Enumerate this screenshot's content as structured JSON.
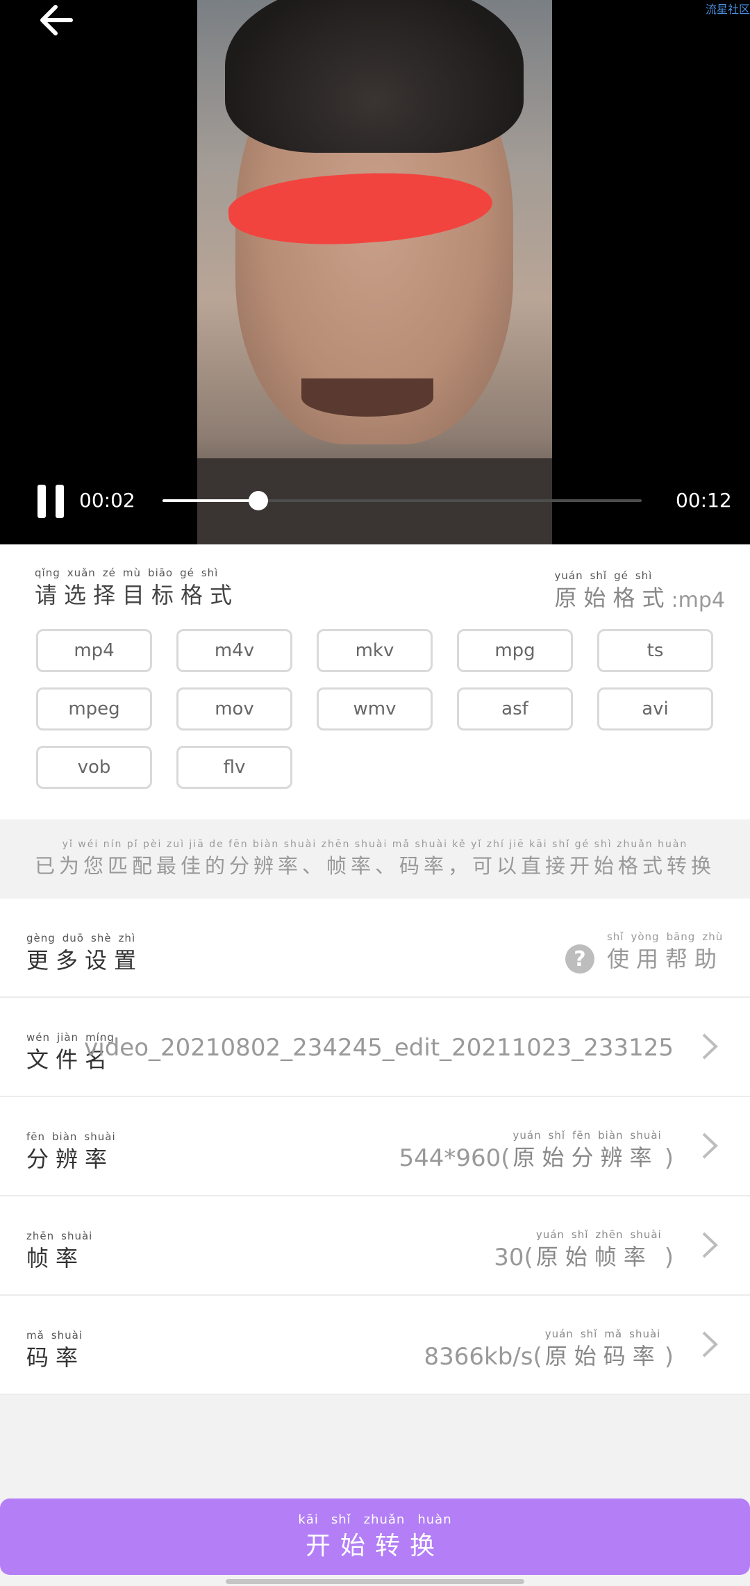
{
  "player": {
    "current_time": "00:02",
    "total_time": "00:12",
    "progress": 0.2,
    "corner_tag": "流星社区"
  },
  "format": {
    "title_pinyin": [
      "qǐng",
      "xuǎn",
      "zé",
      "mù",
      "biāo",
      "gé",
      "shì"
    ],
    "title": "请选择目标格式",
    "original_pinyin": [
      "yuán",
      "shǐ",
      "gé",
      "shì"
    ],
    "original_label": "原始格式",
    "original_value": ":mp4",
    "options": [
      "mp4",
      "m4v",
      "mkv",
      "mpg",
      "ts",
      "mpeg",
      "mov",
      "wmv",
      "asf",
      "avi",
      "vob",
      "flv"
    ]
  },
  "tip": {
    "pinyin": "yǐ wéi nín pǐ pèi zuì jiā de fēn biàn shuài zhēn shuài mǎ shuài kě yǐ zhí jiē kāi shǐ gé shì zhuǎn huàn",
    "text": "已为您匹配最佳的分辨率、帧率、码率，可以直接开始格式转换"
  },
  "more": {
    "pinyin": [
      "gèng",
      "duō",
      "shè",
      "zhì"
    ],
    "label": "更多设置",
    "help_pinyin": [
      "shǐ",
      "yòng",
      "bāng",
      "zhù"
    ],
    "help_label": "使用帮助",
    "help_icon": "?"
  },
  "rows": {
    "filename": {
      "pinyin": [
        "wén",
        "jiàn",
        "míng"
      ],
      "label": "文件名",
      "value": "video_20210802_234245_edit_20211023_233125"
    },
    "resolution": {
      "pinyin": [
        "fēn",
        "biàn",
        "shuài"
      ],
      "label": "分辨率",
      "value": "544*960(",
      "note_pinyin": [
        "yuán",
        "shǐ",
        "fēn",
        "biàn",
        "shuài"
      ],
      "note": "原始分辨率",
      "close": ")"
    },
    "framerate": {
      "pinyin": [
        "zhēn",
        "shuài"
      ],
      "label": "帧率",
      "value": "30(",
      "note_pinyin": [
        "yuán",
        "shǐ",
        "zhēn",
        "shuài"
      ],
      "note": "原始帧率",
      "close": ")"
    },
    "bitrate": {
      "pinyin": [
        "mǎ",
        "shuài"
      ],
      "label": "码率",
      "value": "8366kb/s(",
      "note_pinyin": [
        "yuán",
        "shǐ",
        "mǎ",
        "shuài"
      ],
      "note": "原始码率",
      "close": ")"
    }
  },
  "start": {
    "pinyin": [
      "kāi",
      "shǐ",
      "zhuǎn",
      "huàn"
    ],
    "label": "开始转换"
  },
  "colors": {
    "accent": "#b37ef6",
    "redaction": "#f2443f"
  }
}
